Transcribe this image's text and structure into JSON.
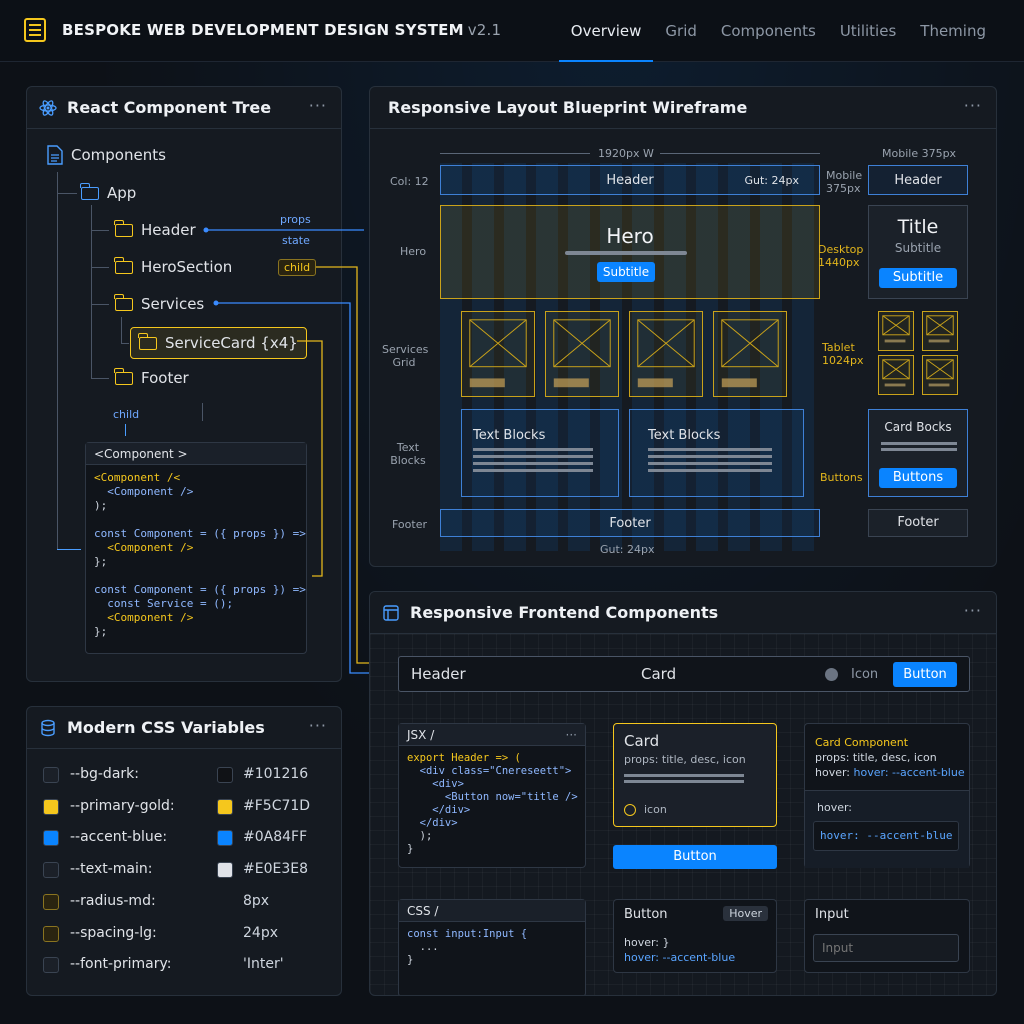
{
  "header": {
    "title": "BESPOKE WEB DEVELOPMENT DESIGN SYSTEM",
    "version": "v2.1"
  },
  "nav": [
    "Overview",
    "Grid",
    "Components",
    "Utilities",
    "Theming"
  ],
  "tree": {
    "title": "React Component Tree",
    "root": "Components",
    "app": "App",
    "items": [
      "Header",
      "HeroSection",
      "Services",
      "ServiceCard {x4}",
      "Footer"
    ],
    "labels": {
      "props": "props",
      "state": "state",
      "child": "child",
      "child2": "child"
    },
    "code_title": "<Component >",
    "code": [
      "<Component /<",
      "  <Component />",
      ");",
      "",
      "const Component = ({ props }) =>",
      "  <Component />",
      "};",
      "",
      "const Component = ({ props }) =>",
      "  const Service = ();",
      "  <Component />",
      "};"
    ]
  },
  "wire": {
    "title": "Responsive Layout Blueprint Wireframe",
    "width_label": "1920px W",
    "mobile_label": "Mobile 375px",
    "col_label": "Col: 12",
    "gut_top": "Gut: 24px",
    "gut_bottom": "Gut: 24px",
    "rows": [
      "Hero",
      "Services Grid",
      "Text Blocks",
      "Footer"
    ],
    "header": "Header",
    "hero": "Hero",
    "subtitle": "Subtitle",
    "text_blocks": [
      "Text Blocks",
      "Text Blocks"
    ],
    "footer": "Footer",
    "side": {
      "mobile": "Mobile 375px",
      "desktop": "Desktop 1440px",
      "tablet": "Tablet 1024px",
      "buttons": "Buttons"
    },
    "m_header": "Header",
    "m_title": "Title",
    "m_subtitle": "Subtitle",
    "m_btn": "Subtitle",
    "m_card": "Card Bocks",
    "m_buttons": "Buttons",
    "m_footer": "Footer"
  },
  "comps": {
    "title": "Responsive Frontend Components",
    "bar": {
      "header": "Header",
      "card": "Card",
      "icon": "Icon",
      "button": "Button"
    },
    "jsx_title": "JSX /",
    "jsx": [
      "export Header => (",
      "  <div class=\"Cnereseett\">",
      "    <div>",
      "      <Button now=\"title />",
      "    </div>",
      "  </div>",
      "  );",
      "}"
    ],
    "card": {
      "title": "Card",
      "props": "props: title, desc, icon",
      "icon": "icon"
    },
    "card_btn": "Button",
    "cc": {
      "title": "Card Component",
      "props": "props: title, desc, icon",
      "hover": "hover: --accent-blue",
      "hover_label": "hover:",
      "hover_code": "hover: --accent-blue"
    },
    "css_title": "CSS /",
    "css": [
      "const input:Input {",
      "  ...",
      "}"
    ],
    "button_box": {
      "title": "Button",
      "badge": "Hover",
      "l1": "hover: }",
      "l2": "hover: --accent-blue"
    },
    "input_box": {
      "title": "Input",
      "placeholder": "Input"
    }
  },
  "vars": {
    "title": "Modern CSS Variables",
    "rows": [
      {
        "name": "--bg-dark:",
        "value": "#101216",
        "color": "#101216",
        "sw": "#1b2028"
      },
      {
        "name": "--primary-gold:",
        "value": "#F5C71D",
        "color": "#F5C71D",
        "sw": "#F5C71D"
      },
      {
        "name": "--accent-blue:",
        "value": "#0A84FF",
        "color": "#0A84FF",
        "sw": "#0A84FF"
      },
      {
        "name": "--text-main:",
        "value": "#E0E3E8",
        "color": "#E0E3E8",
        "sw": "#1b2028"
      },
      {
        "name": "--radius-md:",
        "value": "8px",
        "sw": "#2a2410"
      },
      {
        "name": "--spacing-lg:",
        "value": "24px",
        "sw": "#2a2410"
      },
      {
        "name": "--font-primary:",
        "value": "'Inter'",
        "sw": "#1b2028"
      }
    ]
  }
}
